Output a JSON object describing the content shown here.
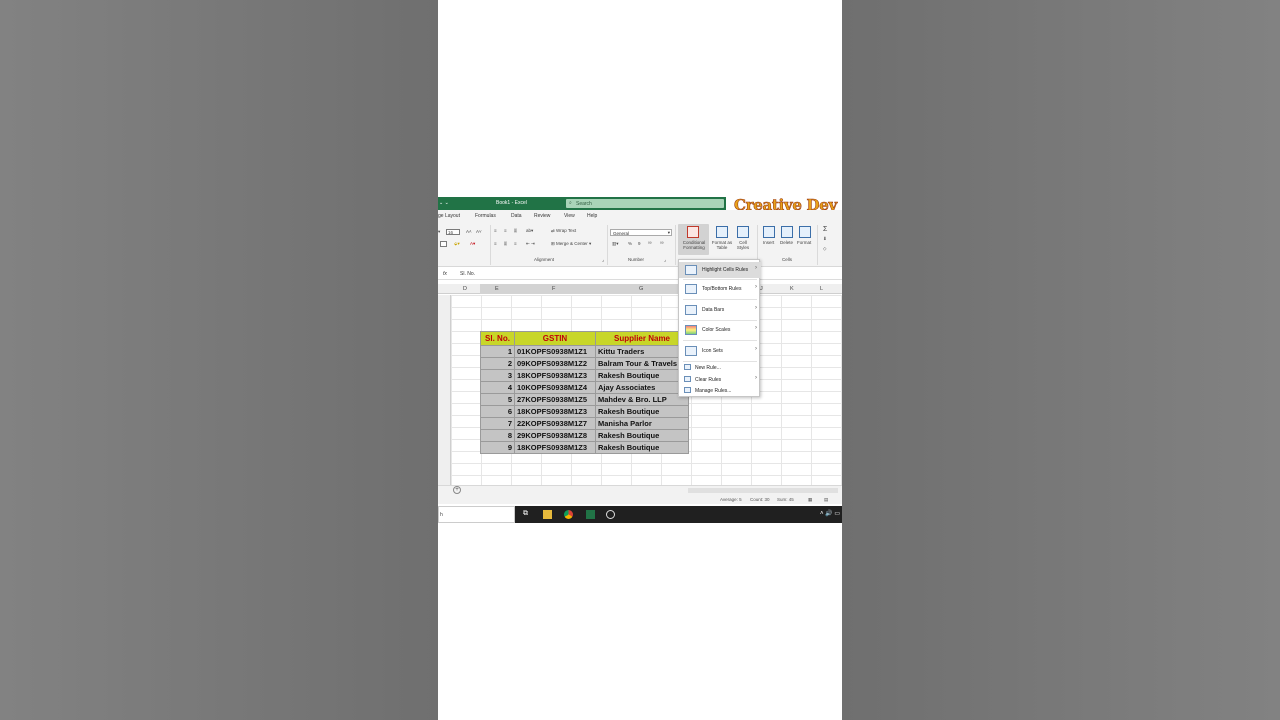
{
  "watermark": {
    "text": "Creative Dev"
  },
  "window": {
    "controls": "⌄ ⌄",
    "title": "Book1 - Excel",
    "search_placeholder": "Search"
  },
  "menu_tabs": [
    "ge Layout",
    "Formulas",
    "Data",
    "Review",
    "View",
    "Help"
  ],
  "ribbon": {
    "font_size": "16",
    "wrap_text": "Wrap Text",
    "merge_center": "Merge & Center",
    "alignment_label": "Alignment",
    "number_format": "General",
    "number_label": "Number",
    "conditional_formatting": "Conditional Formatting",
    "format_as_table": "Format as Table",
    "cell_styles": "Cell Styles",
    "insert": "Insert",
    "delete": "Delete",
    "format": "Format",
    "cells_label": "Cells"
  },
  "formula_bar": {
    "fx": "fx",
    "value": "Sl. No."
  },
  "columns": [
    "D",
    "E",
    "F",
    "G",
    "J",
    "K",
    "L"
  ],
  "table": {
    "headers": [
      "Sl. No.",
      "GSTIN",
      "Supplier Name"
    ],
    "rows": [
      [
        "1",
        "01KOPFS0938M1Z1",
        "Kittu Traders"
      ],
      [
        "2",
        "09KOPFS0938M1Z2",
        "Balram Tour & Travels"
      ],
      [
        "3",
        "18KOPFS0938M1Z3",
        "Rakesh Boutique"
      ],
      [
        "4",
        "10KOPFS0938M1Z4",
        "Ajay Associates"
      ],
      [
        "5",
        "27KOPFS0938M1Z5",
        "Mahdev & Bro. LLP"
      ],
      [
        "6",
        "18KOPFS0938M1Z3",
        "Rakesh Boutique"
      ],
      [
        "7",
        "22KOPFS0938M1Z7",
        "Manisha Parlor"
      ],
      [
        "8",
        "29KOPFS0938M1Z8",
        "Rakesh Boutique"
      ],
      [
        "9",
        "18KOPFS0938M1Z3",
        "Rakesh Boutique"
      ]
    ]
  },
  "dropdown": {
    "highlight_cells_rules": "Highlight Cells Rules",
    "top_bottom_rules": "Top/Bottom Rules",
    "data_bars": "Data Bars",
    "color_scales": "Color Scales",
    "icon_sets": "Icon Sets",
    "new_rule": "New Rule...",
    "clear_rules": "Clear Rules",
    "manage_rules": "Manage Rules..."
  },
  "status_bar": {
    "average": "Average: 5",
    "count": "Count: 30",
    "sum": "Sum: 45"
  },
  "taskbar": {
    "search_text": "h"
  },
  "colors": {
    "excel_green": "#217346",
    "header_fill": "#c8d629",
    "header_text": "#c0000b",
    "selection_fill": "#c4c4c4",
    "watermark": "#e8a21a"
  }
}
